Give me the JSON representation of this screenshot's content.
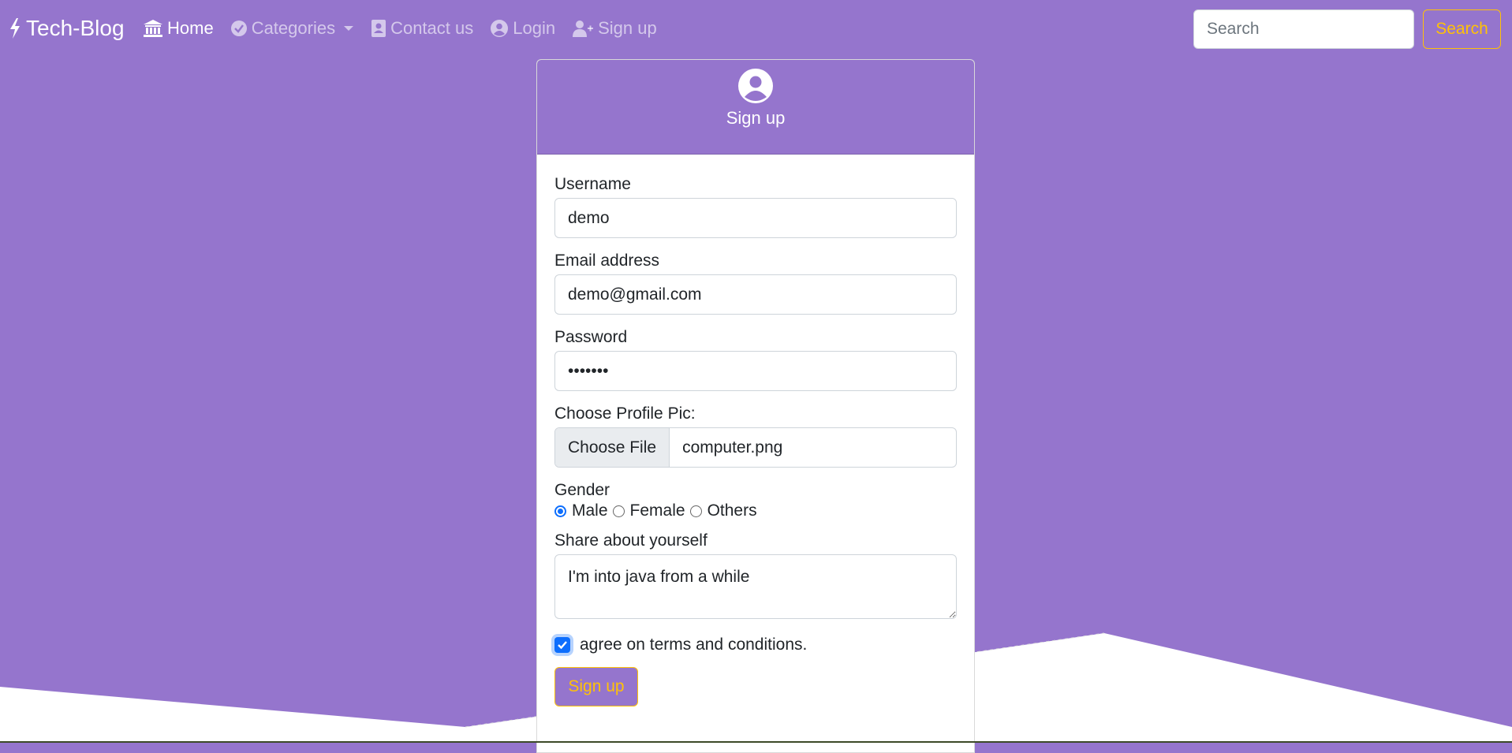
{
  "colors": {
    "background": "#9575cd",
    "accent": "#ffc107",
    "checkbox": "#0d6efd"
  },
  "navbar": {
    "brand": "Tech-Blog",
    "brand_icon": "bolt-icon",
    "links": [
      {
        "label": "Home",
        "icon": "bank-icon",
        "active": true
      },
      {
        "label": "Categories",
        "icon": "check-circle-icon",
        "dropdown": true
      },
      {
        "label": "Contact us",
        "icon": "contact-card-icon"
      },
      {
        "label": "Login",
        "icon": "user-circle-icon"
      },
      {
        "label": "Sign up",
        "icon": "user-plus-icon"
      }
    ],
    "search": {
      "placeholder": "Search",
      "button_label": "Search"
    }
  },
  "signup_card": {
    "header_icon": "user-circle-icon",
    "title": "Sign up",
    "username": {
      "label": "Username",
      "value": "demo"
    },
    "email": {
      "label": "Email address",
      "value": "demo@gmail.com"
    },
    "password": {
      "label": "Password",
      "value": "•••••••"
    },
    "profile_pic": {
      "label": "Choose Profile Pic:",
      "button_label": "Choose File",
      "file_name": "computer.png"
    },
    "gender": {
      "label": "Gender",
      "options": [
        {
          "label": "Male",
          "checked": true
        },
        {
          "label": "Female",
          "checked": false
        },
        {
          "label": "Others",
          "checked": false
        }
      ]
    },
    "about": {
      "label": "Share about yourself",
      "value": "I'm into java from a while"
    },
    "terms": {
      "label": "agree on terms and conditions.",
      "checked": true
    },
    "submit_label": "Sign up"
  }
}
